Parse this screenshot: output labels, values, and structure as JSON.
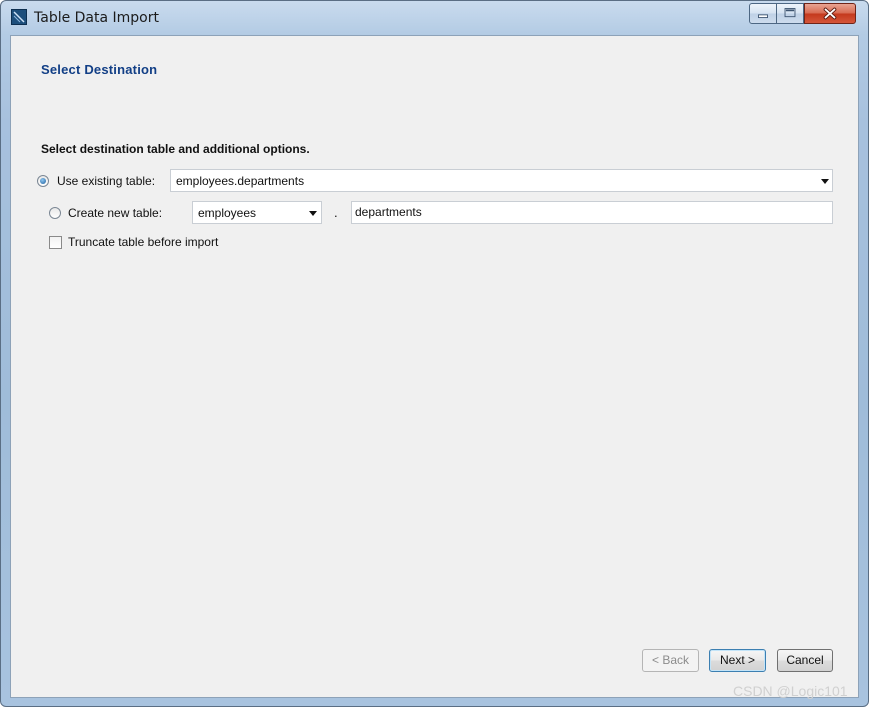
{
  "window": {
    "title": "Table Data Import"
  },
  "page": {
    "title": "Select Destination",
    "subtitle": "Select destination table and additional options."
  },
  "options": {
    "use_existing_label": "Use existing table:",
    "use_existing_selected": true,
    "existing_table_value": "employees.departments",
    "create_new_label": "Create new table:",
    "create_new_selected": false,
    "schema_value": "employees",
    "separator": ".",
    "new_table_name": "departments",
    "truncate_label": "Truncate table before import",
    "truncate_checked": false
  },
  "buttons": {
    "back": "< Back",
    "next": "Next >",
    "cancel": "Cancel"
  },
  "watermark": "CSDN @Logic101"
}
